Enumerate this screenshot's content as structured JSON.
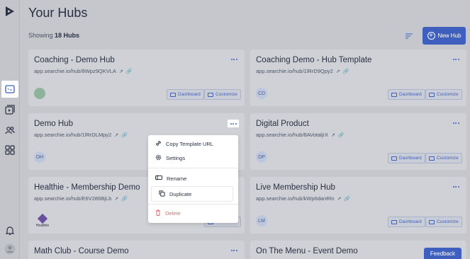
{
  "page": {
    "title": "Your Hubs",
    "showing_prefix": "Showing",
    "showing_count": "18 Hubs",
    "new_hub": "New Hub",
    "feedback": "Feedback"
  },
  "cards": [
    {
      "name": "Coaching - Demo Hub",
      "url": "app.searchie.io/hub/8Wpz9QKVLA",
      "avatar": "",
      "buttons": [
        "Dashboard",
        "Customize"
      ]
    },
    {
      "name": "Coaching Demo - Hub Template",
      "url": "app.searchie.io/hub/1lRrD9Qpy2",
      "avatar": "CD",
      "buttons": [
        "Dashboard",
        "Customize"
      ]
    },
    {
      "name": "Demo Hub",
      "url": "app.searchie.io/hub/1lRrDLMpy2",
      "avatar": "DH",
      "buttons": []
    },
    {
      "name": "Digital Product",
      "url": "app.searchie.io/hub/8AVotaljrX",
      "avatar": "DP",
      "buttons": [
        "Dashboard",
        "Customize"
      ]
    },
    {
      "name": "Healthie - Membership Demo",
      "url": "app.searchie.io/hub/E6V286BjLb",
      "avatar": "Healthie",
      "buttons": [
        "Customize"
      ]
    },
    {
      "name": "Live Membership Hub",
      "url": "app.searchie.io/hub/kWp6danRln",
      "avatar": "LM",
      "buttons": [
        "Dashboard",
        "Customize"
      ]
    },
    {
      "name": "Math Club - Course Demo",
      "url": "",
      "avatar": "",
      "buttons": []
    },
    {
      "name": "On The Menu - Event Demo",
      "url": "",
      "avatar": "",
      "buttons": []
    }
  ],
  "menu": {
    "copy": "Copy Template URL",
    "settings": "Settings",
    "rename": "Rename",
    "duplicate": "Duplicate",
    "delete": "Delete"
  },
  "colors": {
    "accent": "#3f5fbf",
    "danger": "#e46b6b",
    "overlay_bg": "#c5c7cd"
  },
  "icons": [
    "logo-icon",
    "hubs-icon",
    "media-icon",
    "people-icon",
    "apps-icon",
    "bell-icon",
    "user-icon",
    "sort-icon",
    "external-link-icon",
    "link-icon",
    "more-icon"
  ]
}
